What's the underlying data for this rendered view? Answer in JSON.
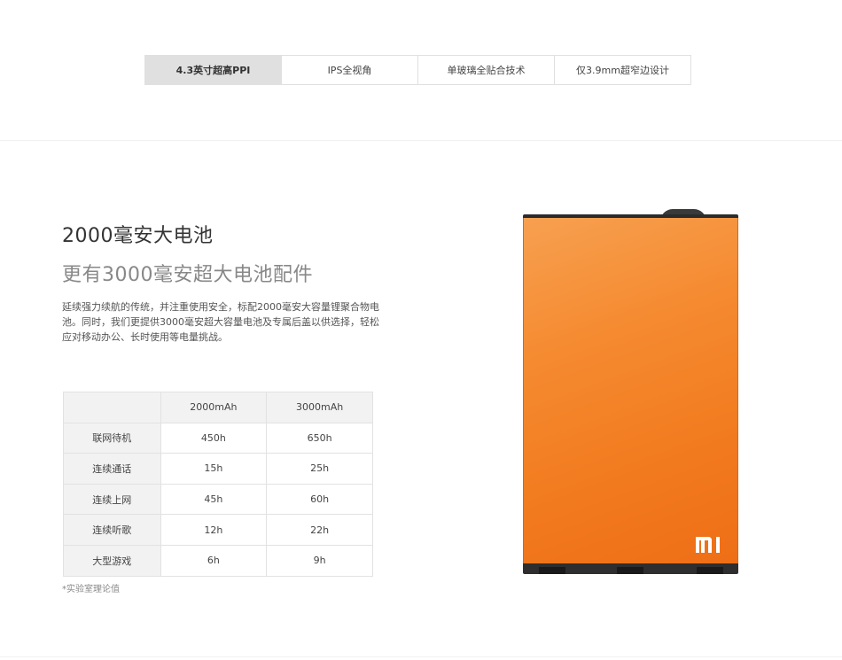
{
  "tabs": [
    {
      "label": "4.3英寸超高PPI",
      "active": true
    },
    {
      "label": "IPS全视角",
      "active": false
    },
    {
      "label": "单玻璃全贴合技术",
      "active": false
    },
    {
      "label": "仅3.9mm超窄边设计",
      "active": false
    }
  ],
  "section": {
    "title": "2000毫安大电池",
    "subtitle": "更有3000毫安超大电池配件",
    "description": "延续强力续航的传统，并注重使用安全，标配2000毫安大容量锂聚合物电池。同时，我们更提供3000毫安超大容量电池及专属后盖以供选择，轻松应对移动办公、长时使用等电量挑战。"
  },
  "table": {
    "headers": [
      "",
      "2000mAh",
      "3000mAh"
    ],
    "rows": [
      {
        "label": "联网待机",
        "v2000": "450h",
        "v3000": "650h"
      },
      {
        "label": "连续通话",
        "v2000": "15h",
        "v3000": "25h"
      },
      {
        "label": "连续上网",
        "v2000": "45h",
        "v3000": "60h"
      },
      {
        "label": "连续听歌",
        "v2000": "12h",
        "v3000": "22h"
      },
      {
        "label": "大型游戏",
        "v2000": "6h",
        "v3000": "9h"
      }
    ]
  },
  "footnote": "*实验室理论值",
  "battery": {
    "logo_icon": "mi-logo-icon",
    "body_color": "#f58a30",
    "cap_color": "#2b2b2b",
    "logo_color": "#ffffff"
  }
}
